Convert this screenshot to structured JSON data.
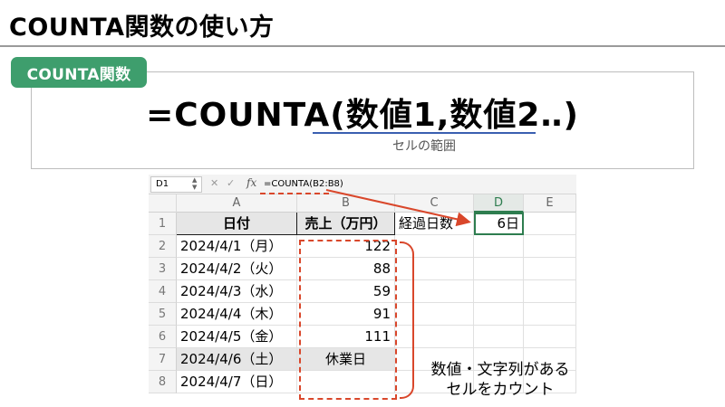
{
  "title": "COUNTA関数の使い方",
  "badge": "COUNTA関数",
  "syntax": {
    "formula": "=COUNTA(数値1,数値2‥)",
    "caption": "セルの範囲"
  },
  "sheet": {
    "name_box": "D1",
    "formula": "=COUNTA(B2:B8)",
    "icons": {
      "cancel": "cancel-x-icon",
      "confirm": "checkmark-icon",
      "fx": "fx-icon"
    },
    "columns": [
      "A",
      "B",
      "C",
      "D",
      "E"
    ],
    "rows": [
      {
        "num": "1",
        "a": "日付",
        "b": "売上（万円）",
        "c": "経過日数",
        "d": "6日",
        "e": ""
      },
      {
        "num": "2",
        "a": "2024/4/1（月）",
        "b": "122",
        "c": "",
        "d": "",
        "e": ""
      },
      {
        "num": "3",
        "a": "2024/4/2（火）",
        "b": "88",
        "c": "",
        "d": "",
        "e": ""
      },
      {
        "num": "4",
        "a": "2024/4/3（水）",
        "b": "59",
        "c": "",
        "d": "",
        "e": ""
      },
      {
        "num": "5",
        "a": "2024/4/4（木）",
        "b": "91",
        "c": "",
        "d": "",
        "e": ""
      },
      {
        "num": "6",
        "a": "2024/4/5（金）",
        "b": "111",
        "c": "",
        "d": "",
        "e": ""
      },
      {
        "num": "7",
        "a": "2024/4/6（土）",
        "b": "休業日",
        "c": "",
        "d": "",
        "e": ""
      },
      {
        "num": "8",
        "a": "2024/4/7（日）",
        "b": "",
        "c": "",
        "d": "",
        "e": ""
      }
    ]
  },
  "annotation": {
    "line1": "数値・文字列がある",
    "line2": "セルをカウント"
  },
  "colors": {
    "accent_green": "#3e9e6d",
    "highlight_red": "#d9472b",
    "underline_blue": "#3a5fb0",
    "selection_green": "#2e7d4f"
  }
}
